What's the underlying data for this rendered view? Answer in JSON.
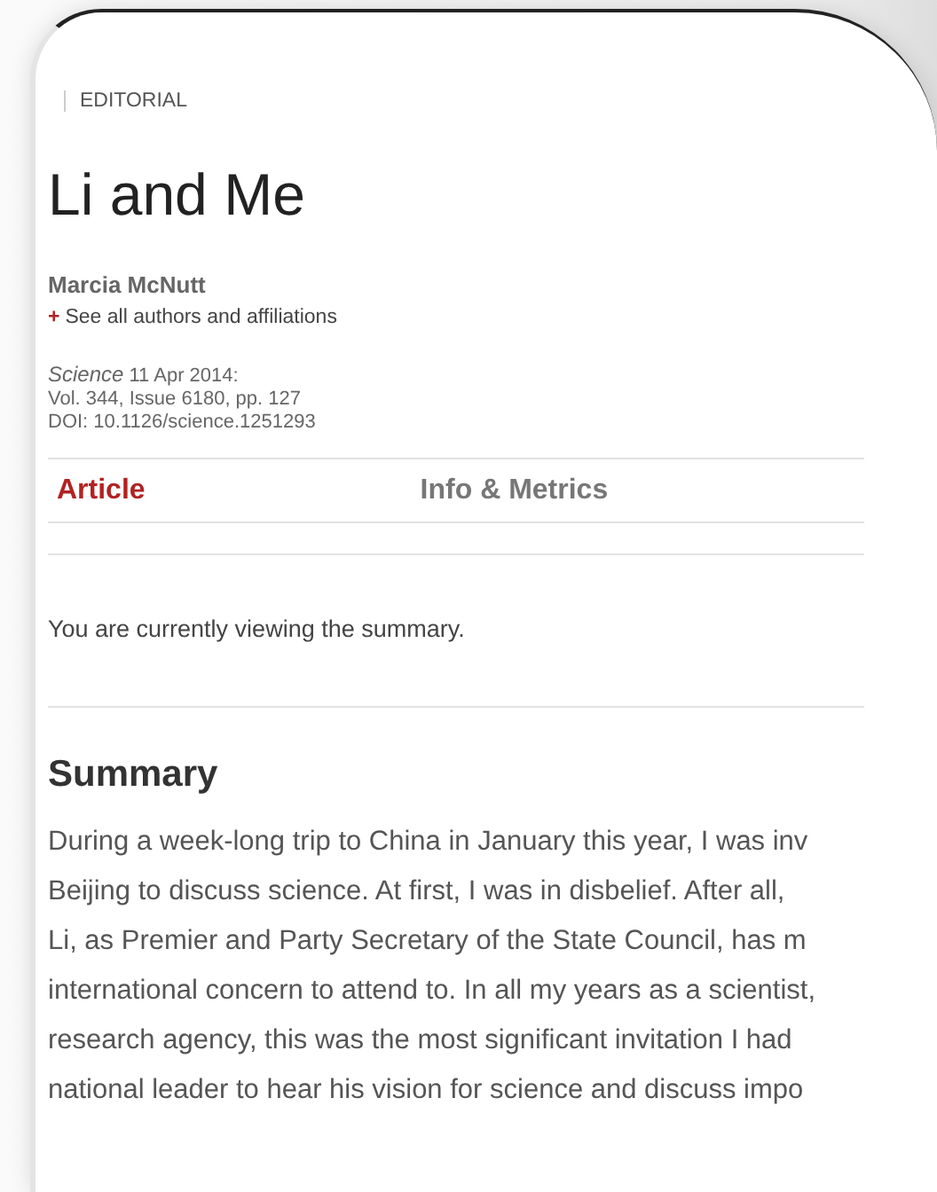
{
  "section_label": "EDITORIAL",
  "title": "Li and Me",
  "author": "Marcia McNutt",
  "authors_link": {
    "icon": "+",
    "label": "See all authors and affiliations"
  },
  "citation": {
    "journal": "Science",
    "date": "11 Apr 2014:",
    "volume": "Vol. 344, Issue 6180, pp. 127",
    "doi": "DOI: 10.1126/science.1251293"
  },
  "tabs": [
    {
      "label": "Article",
      "selected": true
    },
    {
      "label": "Info & Metrics",
      "selected": false
    }
  ],
  "notice": "You are currently viewing the summary.",
  "summary": {
    "heading": "Summary",
    "lines": [
      "During a week-long trip to China in January this year, I was inv",
      "Beijing to discuss science. At first, I was in disbelief. After all,",
      "Li, as Premier and Party Secretary of the State Council, has m",
      "international concern to attend to. In all my years as a scientist,",
      "research agency, this was the most significant invitation I had",
      "national leader to hear his vision for science and discuss impo"
    ]
  }
}
